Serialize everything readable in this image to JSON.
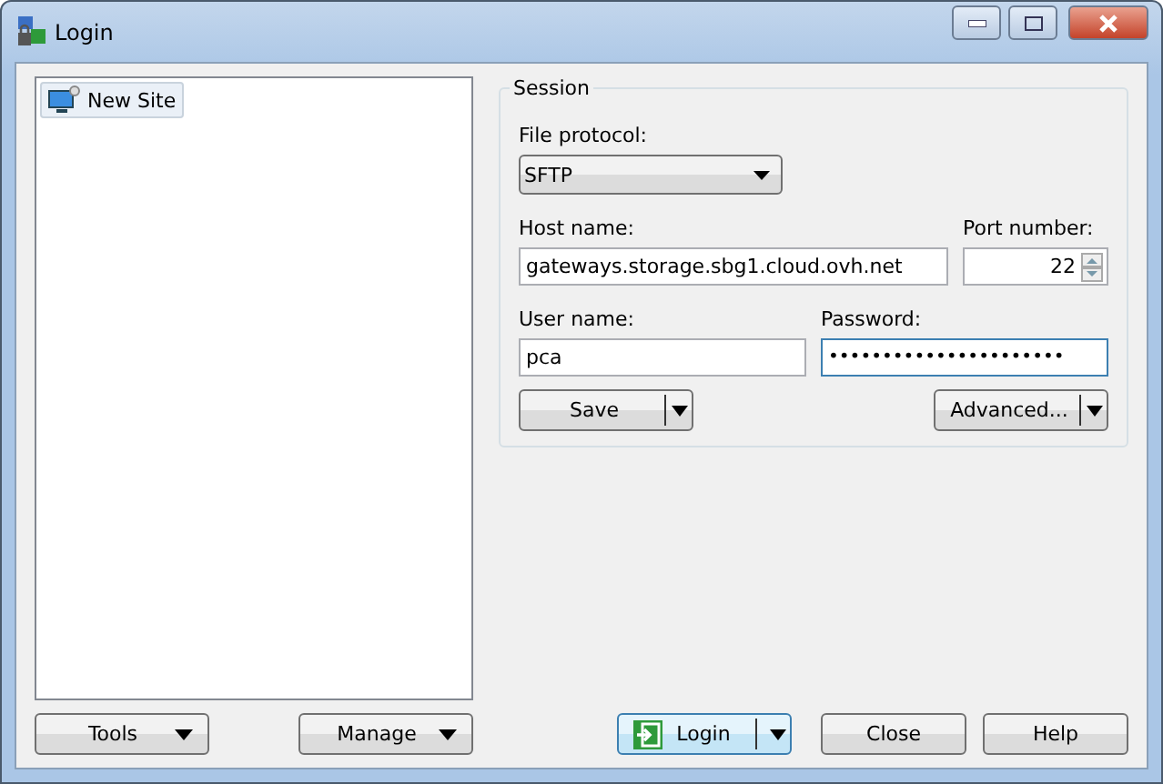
{
  "window": {
    "title": "Login"
  },
  "sites": [
    {
      "label": "New Site",
      "selected": true
    }
  ],
  "session": {
    "title": "Session",
    "file_protocol": {
      "label": "File protocol:",
      "value": "SFTP"
    },
    "host": {
      "label": "Host name:",
      "value": "gateways.storage.sbg1.cloud.ovh.net"
    },
    "port": {
      "label": "Port number:",
      "value": "22"
    },
    "user": {
      "label": "User name:",
      "value": "pca"
    },
    "password": {
      "label": "Password:",
      "value": "••••••••••••••••••••••"
    },
    "save": "Save",
    "advanced": "Advanced..."
  },
  "left_buttons": [
    "Tools",
    "Manage"
  ],
  "buttons": [
    {
      "label": "Login",
      "kind": "split",
      "default": true
    },
    {
      "label": "Close",
      "kind": "plain",
      "default": false
    },
    {
      "label": "Help",
      "kind": "plain",
      "default": false
    }
  ]
}
